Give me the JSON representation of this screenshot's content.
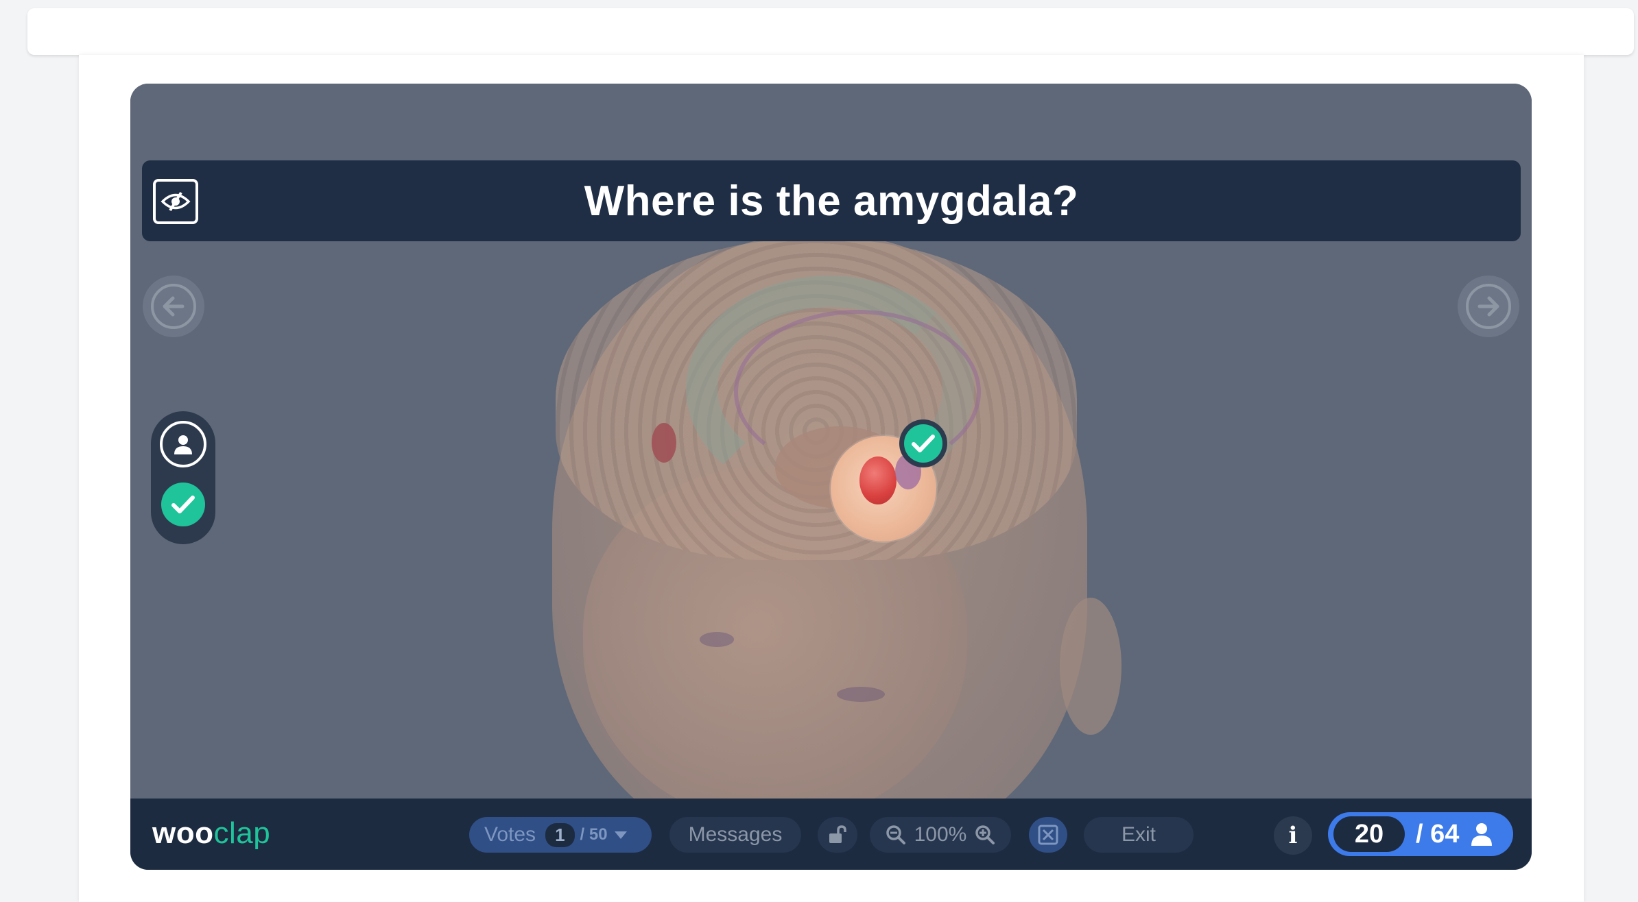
{
  "question": {
    "title": "Where is the amygdala?"
  },
  "logo": {
    "part1": "woo",
    "part2": "clap"
  },
  "toolbar": {
    "votes_label": "Votes",
    "votes_count": "1",
    "votes_total": "/ 50",
    "messages_label": "Messages",
    "zoom_level": "100%",
    "exit_label": "Exit",
    "info_label": "i"
  },
  "participants": {
    "current": "20",
    "total": "/ 64"
  },
  "icons": {
    "hide": "eye-slash-icon",
    "prev": "arrow-left-icon",
    "next": "arrow-right-icon",
    "user": "user-icon",
    "check": "check-icon",
    "lock": "unlock-icon",
    "zoom_out": "zoom-out-icon",
    "zoom_in": "zoom-in-icon",
    "fullscreen": "fullscreen-icon",
    "info": "info-icon"
  },
  "colors": {
    "accent_green": "#1fc49b",
    "accent_blue": "#3e7bea",
    "bar_dark": "#1d2b41"
  }
}
